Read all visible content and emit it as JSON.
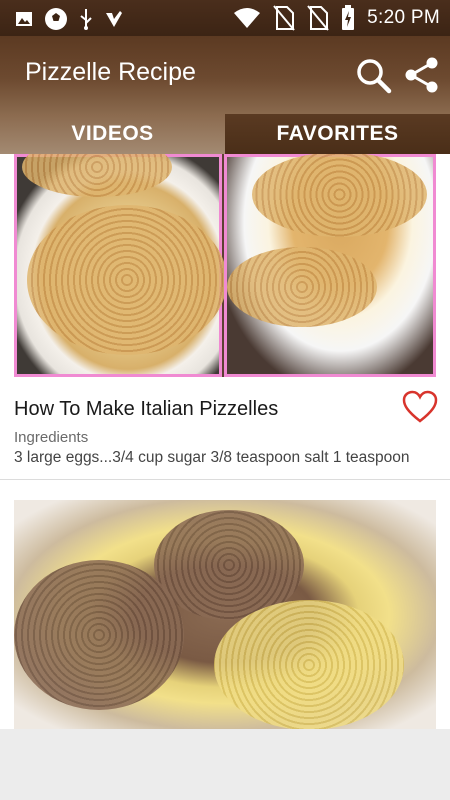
{
  "status_bar": {
    "time": "5:20 PM",
    "left_icons": [
      "image-icon",
      "soccer-ball-icon",
      "usb-icon",
      "checkmark-app-icon"
    ],
    "right_icons": [
      "wifi-icon",
      "no-sim-icon",
      "no-sim-icon",
      "battery-charging-icon"
    ]
  },
  "toolbar": {
    "title": "Pizzelle Recipe",
    "actions": [
      "search-icon",
      "share-icon"
    ]
  },
  "tabs": [
    {
      "label": "VIDEOS",
      "selected": false
    },
    {
      "label": "FAVORITES",
      "selected": true
    }
  ],
  "cards": [
    {
      "title": "How To Make Italian Pizzelles",
      "sub_label": "Ingredients",
      "sub_text": "3 large eggs...3/4 cup sugar 3/8 teaspoon salt 1 teaspoon",
      "favorite": false
    }
  ],
  "colors": {
    "toolbar_top": "#5c3a22",
    "toolbar_bottom": "#8a6a4e",
    "tab_selected": "#4a2e18",
    "heart": "#d8342c"
  }
}
